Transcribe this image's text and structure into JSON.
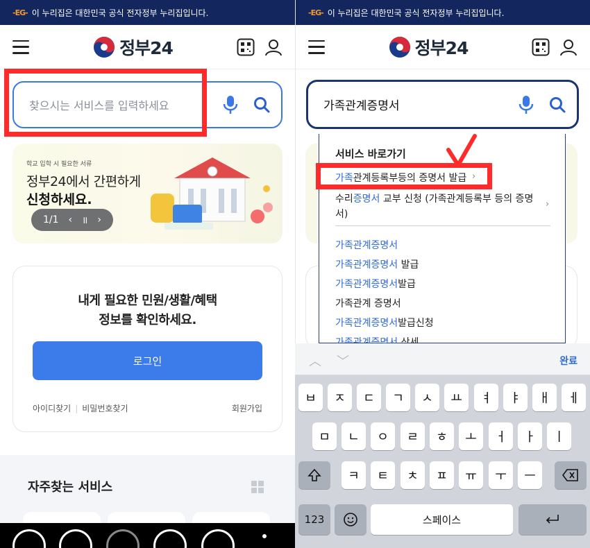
{
  "gov_banner": {
    "mark": "-EG-",
    "text": "이 누리집은 대한민국 공식 전자정부 누리집입니다."
  },
  "header": {
    "logo_text": "정부24"
  },
  "left": {
    "search": {
      "placeholder": "찾으시는 서비스를 입력하세요"
    },
    "banner": {
      "small": "학교 입학 시 필요한 서류",
      "line1": "정부24에서 간편하게",
      "line2": "신청하세요.",
      "pager": {
        "count": "1/1",
        "prev": "‹",
        "pause": "॥",
        "next": "›"
      }
    },
    "login_card": {
      "message_line1": "내게 필요한 민원/생활/혜택",
      "message_line2": "정보를 확인하세요.",
      "login_button": "로그인",
      "find_id": "아이디찾기",
      "sep": "|",
      "find_pw": "비밀번호찾기",
      "signup": "회원가입"
    },
    "frequent": {
      "title": "자주찾는 서비스"
    }
  },
  "right": {
    "search": {
      "value": "가족관계증명서"
    },
    "dropdown": {
      "heading": "서비스 바로가기",
      "shortcuts": [
        {
          "hl": "가족",
          "rest": "관계등록부등의 증명서 발급"
        },
        {
          "pre": "수리",
          "hl": "증명서",
          "rest": " 교부 신청 (가족관계등록부 등의 증명",
          "line2": "서)"
        }
      ],
      "suggestions": [
        {
          "hl": "가족관계증명서",
          "rest": ""
        },
        {
          "hl": "가족관계증명서",
          "rest": " 발급"
        },
        {
          "hl": "가족관계증명서",
          "rest": "발급"
        },
        {
          "hl": "",
          "rest": "가족관계 증명서"
        },
        {
          "hl": "가족관계증명서",
          "rest": "발급신청"
        },
        {
          "hl": "가족관계증명서",
          "rest": " 상세"
        }
      ],
      "chevron": "›"
    },
    "keyboard": {
      "done": "완료",
      "row1": [
        "ㅂ",
        "ㅈ",
        "ㄷ",
        "ㄱ",
        "ㅅ",
        "ㅛ",
        "ㅕ",
        "ㅑ",
        "ㅐ",
        "ㅔ"
      ],
      "row2": [
        "ㅁ",
        "ㄴ",
        "ㅇ",
        "ㄹ",
        "ㅎ",
        "ㅗ",
        "ㅓ",
        "ㅏ",
        "ㅣ"
      ],
      "row3": [
        "ㅋ",
        "ㅌ",
        "ㅊ",
        "ㅍ",
        "ㅠ",
        "ㅜ",
        "ㅡ"
      ],
      "num_key": "123",
      "space_key": "스페이스"
    }
  },
  "colors": {
    "accent": "#3b7bea",
    "navy": "#13265e",
    "highlight": "#2f6ad6",
    "annotation_red": "#ff2a2a"
  }
}
